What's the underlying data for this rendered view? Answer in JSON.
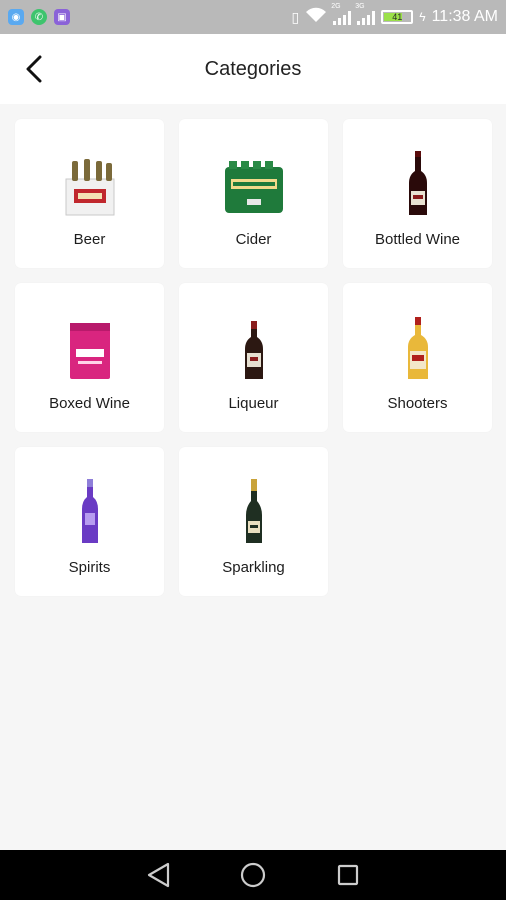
{
  "status_bar": {
    "time": "11:38 AM",
    "battery": "41",
    "network_1": "2G",
    "network_2": "3G"
  },
  "header": {
    "title": "Categories",
    "back_icon": "back-arrow-icon"
  },
  "categories": [
    {
      "label": "Beer",
      "image": "six-pack-icon"
    },
    {
      "label": "Cider",
      "image": "cider-pack-icon"
    },
    {
      "label": "Bottled Wine",
      "image": "wine-bottle-icon"
    },
    {
      "label": "Boxed Wine",
      "image": "wine-box-icon"
    },
    {
      "label": "Liqueur",
      "image": "liqueur-bottle-icon"
    },
    {
      "label": "Shooters",
      "image": "shooter-bottle-icon"
    },
    {
      "label": "Spirits",
      "image": "spirits-bottle-icon"
    },
    {
      "label": "Sparkling",
      "image": "sparkling-bottle-icon"
    }
  ],
  "nav": {
    "back": "nav-back-icon",
    "home": "nav-home-icon",
    "recents": "nav-recents-icon"
  }
}
